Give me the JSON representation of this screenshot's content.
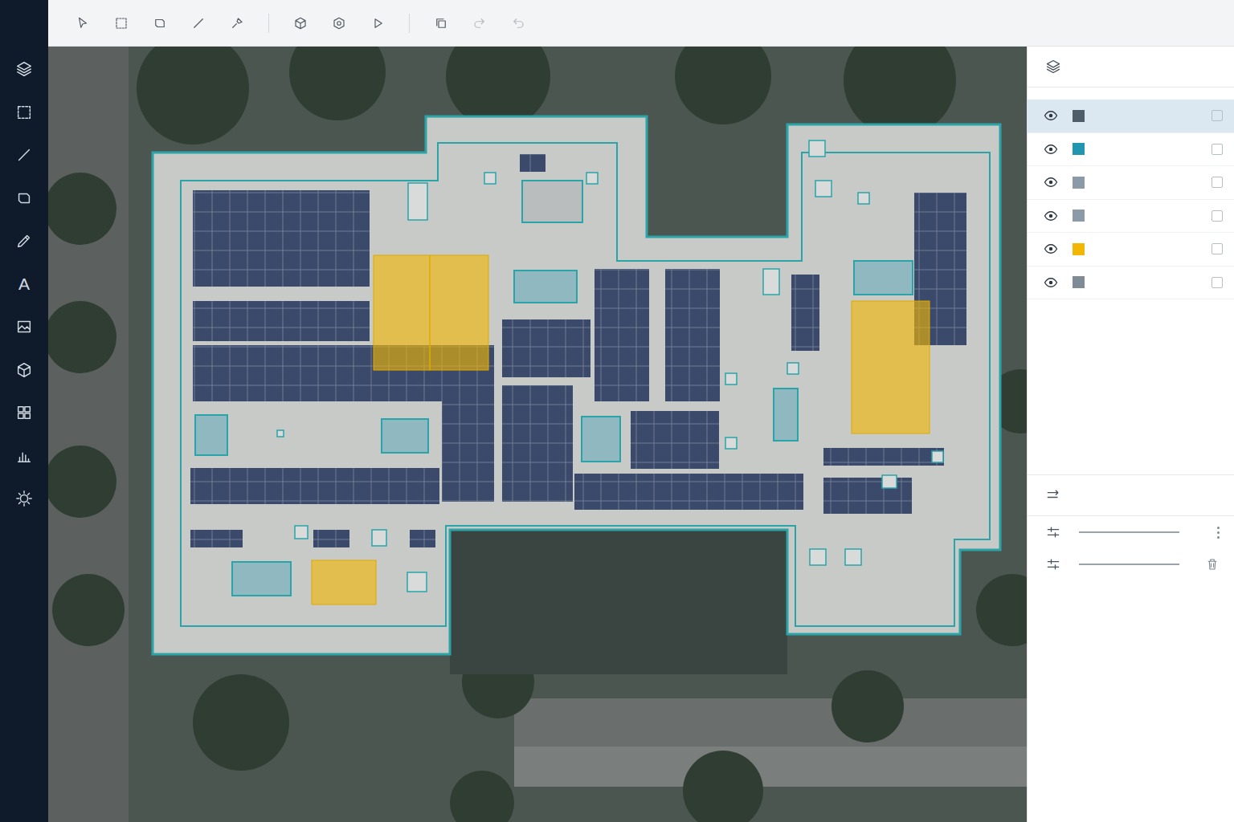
{
  "sidebar": {
    "text_tool": "A"
  },
  "history": {
    "redo": {
      "disabled": true
    },
    "undo": {
      "disabled": true
    }
  },
  "layers": [
    {
      "color": "#4f5d6b",
      "visible": true,
      "checked": false,
      "selected": true
    },
    {
      "color": "#2196b0",
      "visible": true,
      "checked": false,
      "selected": false
    },
    {
      "color": "#8a9aa6",
      "visible": true,
      "checked": false,
      "selected": false
    },
    {
      "color": "#8a9aa6",
      "visible": true,
      "checked": false,
      "selected": false
    },
    {
      "color": "#f2b705",
      "visible": true,
      "checked": false,
      "selected": false
    },
    {
      "color": "#7f8c96",
      "visible": true,
      "checked": false,
      "selected": false
    }
  ]
}
